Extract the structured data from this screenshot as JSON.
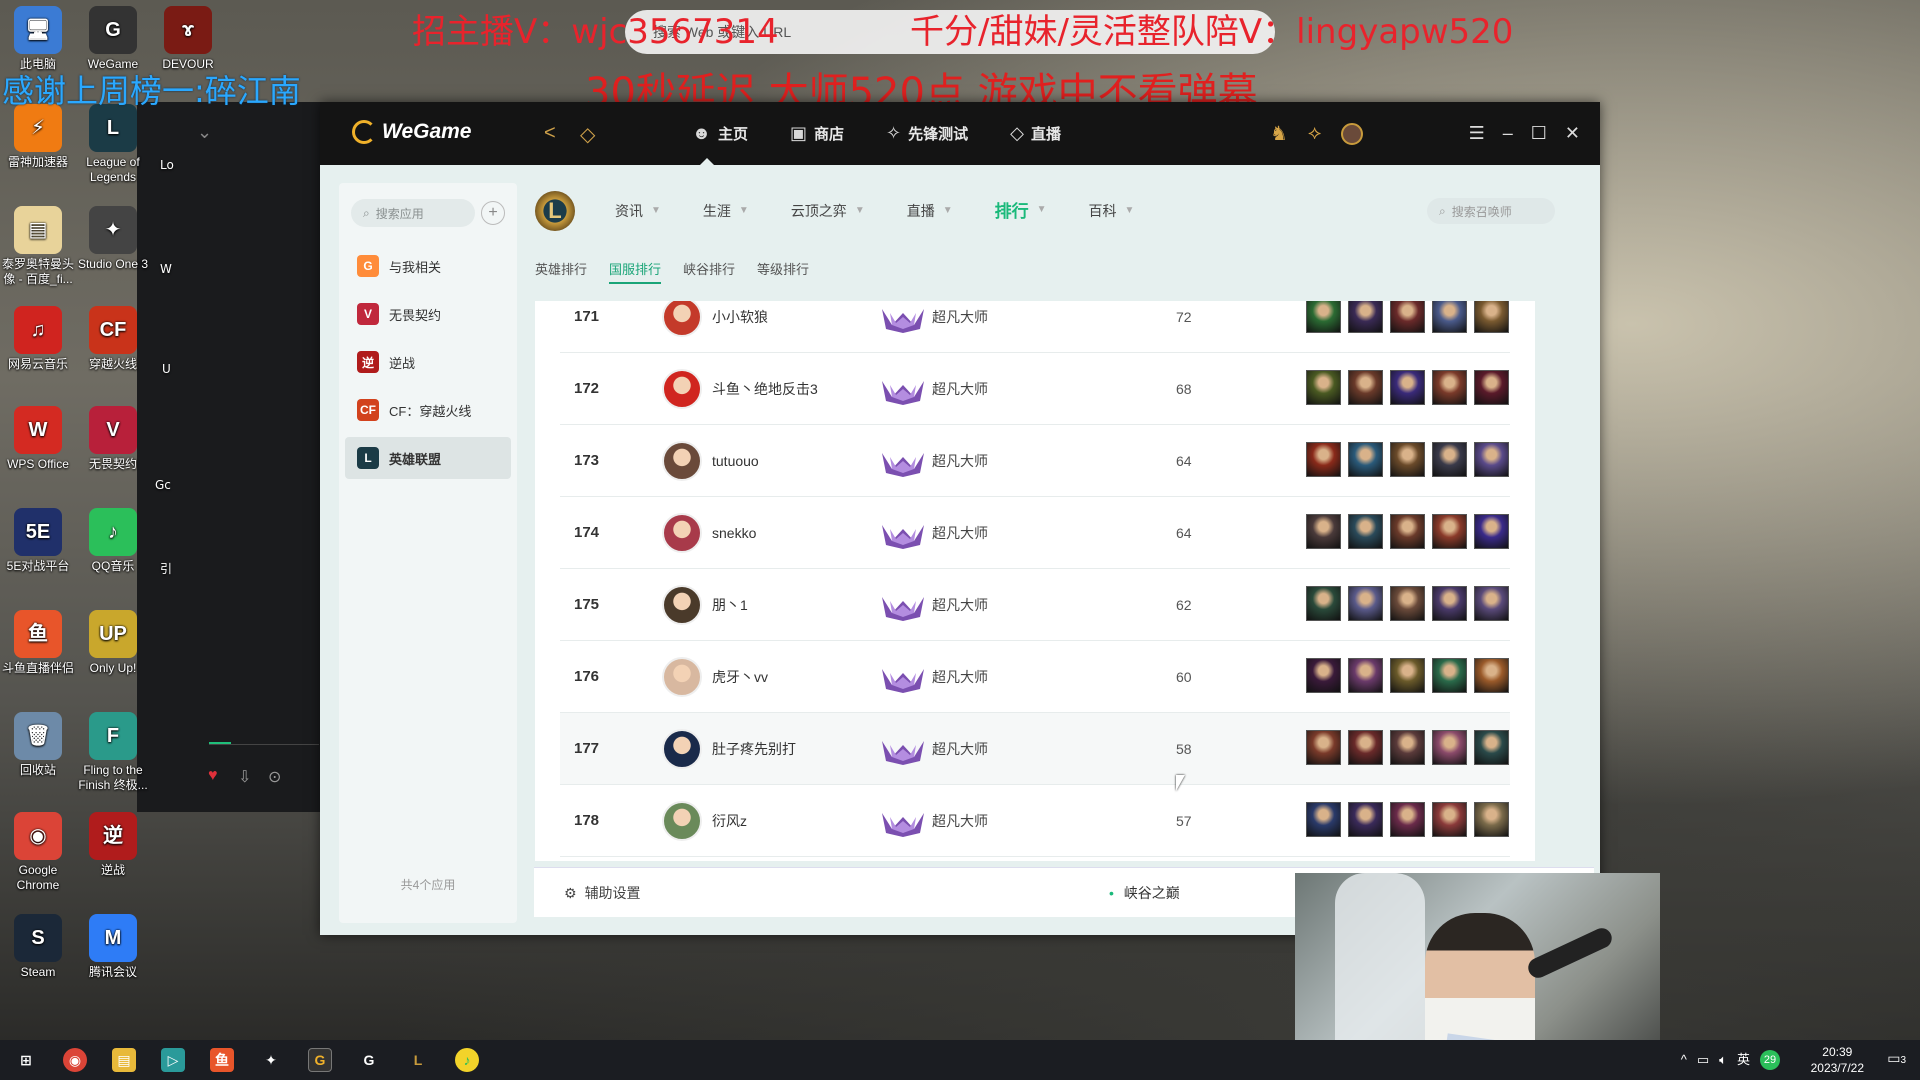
{
  "overlay": {
    "line1_left": "招主播V：wjc3567314",
    "line1_right": "千分/甜妹/灵活整队陪V：lingyapw520",
    "thanks": "感谢上周榜一:碎江南",
    "line2": "30秒延迟   大师520点   游戏中不看弹幕",
    "browser_hint": "搜索 Web 或键入 URL"
  },
  "desktop_icons": [
    {
      "label": "此电脑",
      "color": "#3b7bd4",
      "glyph": "🖥"
    },
    {
      "label": "WeGame",
      "color": "#333333",
      "glyph": "G"
    },
    {
      "label": "DEVOUR",
      "color": "#7a1b14",
      "glyph": "ɤ"
    },
    {
      "label": "雷神加速器",
      "color": "#f07b12",
      "glyph": "⚡"
    },
    {
      "label": "League of Legends",
      "color": "#1b3b46",
      "glyph": "L"
    },
    {
      "label": "泰罗奥特曼头像 - 百度_fi...",
      "color": "#e8d39a",
      "glyph": "▤"
    },
    {
      "label": "Studio One 3",
      "color": "#444444",
      "glyph": "✦"
    },
    {
      "label": "网易云音乐",
      "color": "#d0241f",
      "glyph": "♫"
    },
    {
      "label": "穿越火线",
      "color": "#c9331a",
      "glyph": "CF"
    },
    {
      "label": "WPS Office",
      "color": "#d42a22",
      "glyph": "W"
    },
    {
      "label": "无畏契约",
      "color": "#b8203a",
      "glyph": "V"
    },
    {
      "label": "5E对战平台",
      "color": "#20306a",
      "glyph": "5E"
    },
    {
      "label": "QQ音乐",
      "color": "#2bbf5a",
      "glyph": "♪"
    },
    {
      "label": "斗鱼直播伴侣",
      "color": "#e8552a",
      "glyph": "鱼"
    },
    {
      "label": "Only Up!",
      "color": "#c9a72c",
      "glyph": "UP"
    },
    {
      "label": "回收站",
      "color": "#6d8aa8",
      "glyph": "🗑"
    },
    {
      "label": "Fling to the Finish 终极...",
      "color": "#2a9a8a",
      "glyph": "F"
    },
    {
      "label": "Google Chrome",
      "color": "#db4437",
      "glyph": "◉"
    },
    {
      "label": "逆战",
      "color": "#b01c1c",
      "glyph": "逆"
    },
    {
      "label": "Steam",
      "color": "#1b2838",
      "glyph": "S"
    },
    {
      "label": "腾讯会议",
      "color": "#2e7cf6",
      "glyph": "M"
    }
  ],
  "partial_icons": [
    "Lo",
    "W",
    "U",
    "Gc",
    "引"
  ],
  "wegame": {
    "logo": "WeGame",
    "nav": [
      {
        "label": "主页",
        "icon": "home-icon",
        "glyph": "⌂"
      },
      {
        "label": "商店",
        "icon": "store-icon",
        "glyph": "⛫"
      },
      {
        "label": "先锋测试",
        "icon": "gamepad-icon",
        "glyph": "✧"
      },
      {
        "label": "直播",
        "icon": "live-icon",
        "glyph": "◇"
      }
    ],
    "search_app_placeholder": "搜索应用",
    "sidebar": [
      {
        "label": "与我相关",
        "color": "#ff8c3a",
        "glyph": "G"
      },
      {
        "label": "无畏契约",
        "color": "#c0283c",
        "glyph": "V"
      },
      {
        "label": "逆战",
        "color": "#b01c1c",
        "glyph": "逆"
      },
      {
        "label": "CF：穿越火线",
        "color": "#d2421d",
        "glyph": "CF"
      },
      {
        "label": "英雄联盟",
        "color": "#1b3b46",
        "glyph": "L"
      }
    ],
    "app_count": "共4个应用",
    "game_logo": "L",
    "categories": [
      {
        "label": "资讯",
        "active": false
      },
      {
        "label": "生涯",
        "active": false
      },
      {
        "label": "云顶之弈",
        "active": false
      },
      {
        "label": "直播",
        "active": false
      },
      {
        "label": "排行",
        "active": true
      },
      {
        "label": "百科",
        "active": false
      }
    ],
    "summoner_search_placeholder": "搜索召唤师",
    "sub_tabs": [
      {
        "label": "英雄排行",
        "active": false
      },
      {
        "label": "国服排行",
        "active": true
      },
      {
        "label": "峡谷排行",
        "active": false
      },
      {
        "label": "等级排行",
        "active": false
      }
    ],
    "rows": [
      {
        "rank": "171",
        "name": "小小软狼",
        "tier": "超凡大师",
        "lp": "72",
        "avatar": "#c43a2a",
        "champs": [
          "#2b6b33",
          "#3a2a55",
          "#6a2a2a",
          "#4a5a8a",
          "#7a5a30"
        ]
      },
      {
        "rank": "172",
        "name": "斗鱼丶绝地反击3",
        "tier": "超凡大师",
        "lp": "68",
        "avatar": "#d0251f",
        "champs": [
          "#4a5a22",
          "#6a3a2a",
          "#3a2a7a",
          "#7a3a2a",
          "#5a1a2a"
        ]
      },
      {
        "rank": "173",
        "name": "tutuouo",
        "tier": "超凡大师",
        "lp": "64",
        "avatar": "#6a4a3a",
        "champs": [
          "#8a2a1a",
          "#2a5a7a",
          "#6a4a2a",
          "#3a3a4a",
          "#5a4a8a"
        ]
      },
      {
        "rank": "174",
        "name": "snekko",
        "tier": "超凡大师",
        "lp": "64",
        "avatar": "#a83a4a",
        "champs": [
          "#4a3a3a",
          "#2a4a5a",
          "#6a3a2a",
          "#8a3a2a",
          "#3a2a8a"
        ]
      },
      {
        "rank": "175",
        "name": "朋丶1",
        "tier": "超凡大师",
        "lp": "62",
        "avatar": "#4a3a2a",
        "champs": [
          "#2a4a3a",
          "#5a5a8a",
          "#6a4a3a",
          "#4a3a6a",
          "#5a4a7a"
        ]
      },
      {
        "rank": "176",
        "name": "虎牙丶vv",
        "tier": "超凡大师",
        "lp": "60",
        "avatar": "#d8b8a0",
        "champs": [
          "#3a1a3a",
          "#6a3a6a",
          "#6a5a2a",
          "#2a6a4a",
          "#9a5a2a"
        ]
      },
      {
        "rank": "177",
        "name": "肚子疼先别打",
        "tier": "超凡大师",
        "lp": "58",
        "avatar": "#1a2a4a",
        "champs": [
          "#7a3a2a",
          "#6a2a2a",
          "#5a3a3a",
          "#8a4a6a",
          "#2a4a4a"
        ]
      },
      {
        "rank": "178",
        "name": "衍风z",
        "tier": "超凡大师",
        "lp": "57",
        "avatar": "#6a8a5a",
        "champs": [
          "#2a3a6a",
          "#3a2a5a",
          "#6a2a4a",
          "#8a3a3a",
          "#7a6a4a"
        ]
      }
    ],
    "assist_label": "辅助设置",
    "mode_label": "峡谷之巅"
  },
  "taskbar": {
    "tray_lang": "英",
    "tray_badge": "29",
    "time": "20:39",
    "date": "2023/7/22",
    "notif": "3"
  }
}
